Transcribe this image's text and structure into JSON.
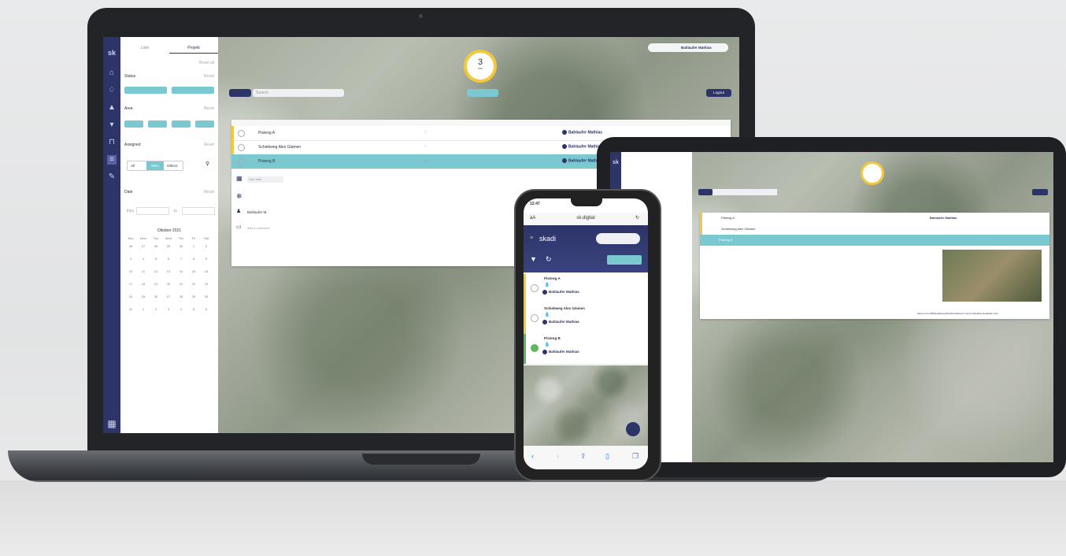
{
  "laptop": {
    "brand": "sk",
    "tabs": [
      "Liste",
      "Projekt"
    ],
    "reset_all": "Reset all",
    "filters": {
      "status_label": "Status",
      "status_reset": "Reset",
      "area_label": "Area",
      "area_reset": "Reset",
      "assigned_label": "Assigned",
      "assigned_reset": "Reset",
      "assigned_options": [
        "All",
        "Mine",
        "Others"
      ],
      "date_label": "Date",
      "date_reset": "Reset",
      "from_label": "from",
      "to_label": "to"
    },
    "calendar": {
      "month": "Oktober 2021",
      "weekdays": [
        "Sun",
        "Mon",
        "Tue",
        "Wed",
        "Thu",
        "Fri",
        "Sat"
      ],
      "days": [
        "26",
        "27",
        "28",
        "29",
        "30",
        "1",
        "2",
        "3",
        "4",
        "5",
        "6",
        "7",
        "8",
        "9",
        "10",
        "11",
        "12",
        "13",
        "14",
        "15",
        "16",
        "17",
        "18",
        "19",
        "20",
        "21",
        "22",
        "23",
        "24",
        "25",
        "26",
        "27",
        "28",
        "29",
        "30",
        "31",
        "1",
        "2",
        "3",
        "4",
        "5",
        "6"
      ]
    },
    "search_placeholder": "Search",
    "gauge": {
      "value": "3",
      "caption": "Jobs"
    },
    "user_pill": {
      "name": "Bahlaufer Mathias"
    },
    "logout": "Logout",
    "rows": [
      {
        "name": "Pisteng A",
        "user": "Bahlaufer Mathias",
        "color": "#f3c83a",
        "selected": false
      },
      {
        "name": "Schiebweg Alex Glamen",
        "user": "Bahlaufer Mathias",
        "color": "#f3c83a",
        "selected": false
      },
      {
        "name": "Pisteng B",
        "user": "Bahlaufer Mathias",
        "color": "#7ac8d0",
        "selected": true
      }
    ],
    "detail": {
      "date": "Due date",
      "assignee": "Bahlaufer M.",
      "comment_placeholder": "Add a comment..."
    }
  },
  "phone": {
    "time": "12:47",
    "aa": "aA",
    "url": "sk.digital",
    "brand": "skadi",
    "rows": [
      {
        "title": "Pisteng A",
        "drop": "💧",
        "user": "Bahlaufer Mathias",
        "color": "#f3c83a"
      },
      {
        "title": "Schiebweg Alex Glamen",
        "drop": "💧",
        "user": "Bahlaufer Mathias",
        "color": "#f3c83a"
      },
      {
        "title": "Pisteng B",
        "drop": "💧",
        "user": "Bahlaufer Mathias",
        "color": "#5cb85c"
      }
    ]
  },
  "tablet": {
    "brand": "sk",
    "rows": [
      "Pisteng A",
      "Schiebweg Alex Glamen",
      "Pisteng B"
    ],
    "user": "Bahlaufer Mathias",
    "footer": "Source of LuftB Erstellung Zwischenkantens: Lizenz Aktuelles Geodaten-Amt"
  },
  "colors": {
    "navy": "#2c3468",
    "teal": "#7ac8d0",
    "yellow": "#f3c83a",
    "green": "#5cb85c"
  }
}
